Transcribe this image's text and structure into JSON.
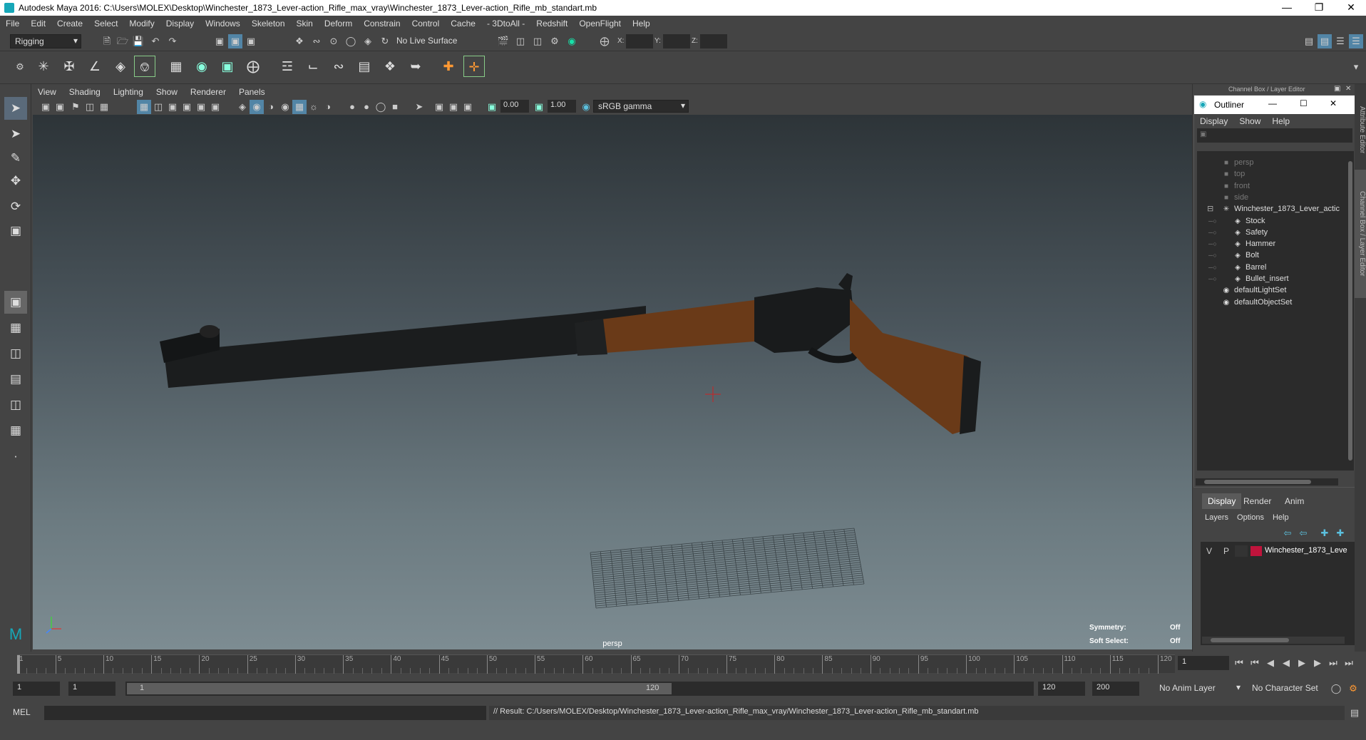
{
  "window": {
    "title": "Autodesk Maya 2016: C:\\Users\\MOLEX\\Desktop\\Winchester_1873_Lever-action_Rifle_max_vray\\Winchester_1873_Lever-action_Rifle_mb_standart.mb"
  },
  "menubar": [
    "File",
    "Edit",
    "Create",
    "Select",
    "Modify",
    "Display",
    "Windows",
    "Skeleton",
    "Skin",
    "Deform",
    "Constrain",
    "Control",
    "Cache",
    "- 3DtoAll -",
    "Redshift",
    "OpenFlight",
    "Help"
  ],
  "statusline": {
    "mode": "Rigging",
    "live_surface": "No Live Surface",
    "x_label": "X:",
    "y_label": "Y:",
    "z_label": "Z:"
  },
  "panel_menu": [
    "View",
    "Shading",
    "Lighting",
    "Show",
    "Renderer",
    "Panels"
  ],
  "panel_tools": {
    "field_a": "0.00",
    "field_b": "1.00",
    "color_space": "sRGB gamma"
  },
  "viewport": {
    "camera": "persp",
    "symmetry_label": "Symmetry:",
    "symmetry_value": "Off",
    "soft_select_label": "Soft Select:",
    "soft_select_value": "Off"
  },
  "right_panel": {
    "header": "Channel Box / Layer Editor"
  },
  "outliner": {
    "title": "Outliner",
    "menu": [
      "Display",
      "Show",
      "Help"
    ],
    "items": [
      {
        "label": "persp",
        "level": 0,
        "icon": "camera-icon",
        "dim": true
      },
      {
        "label": "top",
        "level": 0,
        "icon": "camera-icon",
        "dim": true
      },
      {
        "label": "front",
        "level": 0,
        "icon": "camera-icon",
        "dim": true
      },
      {
        "label": "side",
        "level": 0,
        "icon": "camera-icon",
        "dim": true
      },
      {
        "label": "Winchester_1873_Lever_actic",
        "level": 0,
        "icon": "group-icon",
        "dim": false,
        "expanded": true
      },
      {
        "label": "Stock",
        "level": 1,
        "icon": "mesh-icon",
        "dim": false
      },
      {
        "label": "Safety",
        "level": 1,
        "icon": "mesh-icon",
        "dim": false
      },
      {
        "label": "Hammer",
        "level": 1,
        "icon": "mesh-icon",
        "dim": false
      },
      {
        "label": "Bolt",
        "level": 1,
        "icon": "mesh-icon",
        "dim": false
      },
      {
        "label": "Barrel",
        "level": 1,
        "icon": "mesh-icon",
        "dim": false
      },
      {
        "label": "Bullet_insert",
        "level": 1,
        "icon": "mesh-icon",
        "dim": false
      },
      {
        "label": "defaultLightSet",
        "level": 0,
        "icon": "set-icon",
        "dim": false
      },
      {
        "label": "defaultObjectSet",
        "level": 0,
        "icon": "set-icon",
        "dim": false
      }
    ]
  },
  "layer_editor": {
    "tabs": [
      "Display",
      "Render",
      "Anim"
    ],
    "menu": [
      "Layers",
      "Options",
      "Help"
    ],
    "layer": {
      "v": "V",
      "p": "P",
      "name": "Winchester_1873_Leve",
      "color": "#c0143c"
    }
  },
  "vertical_tabs": [
    "Attribute Editor",
    "Channel Box / Layer Editor"
  ],
  "timeline": {
    "ticks": [
      "1",
      "5",
      "10",
      "15",
      "20",
      "25",
      "30",
      "35",
      "40",
      "45",
      "50",
      "55",
      "60",
      "65",
      "70",
      "75",
      "80",
      "85",
      "90",
      "95",
      "100",
      "105",
      "110",
      "115",
      "120"
    ],
    "current_frame": "1"
  },
  "range": {
    "start": "1",
    "playback_start": "1",
    "slider_start": "1",
    "slider_end": "120",
    "playback_end": "120",
    "end": "200",
    "anim_layer": "No Anim Layer",
    "character_set": "No Character Set"
  },
  "command_line": {
    "label": "MEL",
    "result": "// Result: C:/Users/MOLEX/Desktop/Winchester_1873_Lever-action_Rifle_max_vray/Winchester_1873_Lever-action_Rifle_mb_standart.mb"
  },
  "colors": {
    "accent": "#17a7b8",
    "layer": "#c0143c",
    "stock": "#6a3a18"
  }
}
